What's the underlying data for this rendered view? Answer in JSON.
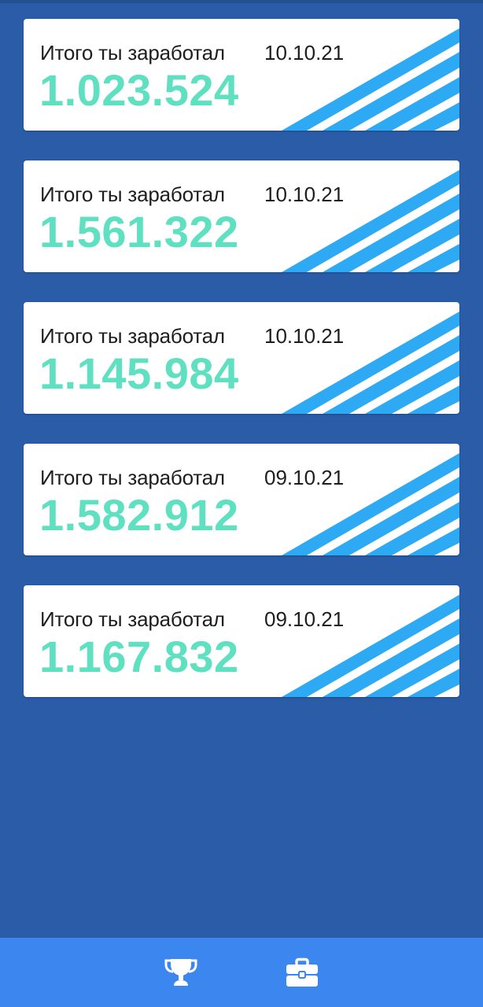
{
  "colors": {
    "background": "#2b5ca8",
    "card": "#ffffff",
    "amount": "#5fe0c0",
    "stripe": "#2eaaf5",
    "bottom_nav": "#3b86ef"
  },
  "cards": [
    {
      "label": "Итого ты заработал",
      "date": "10.10.21",
      "amount": "1.023.524"
    },
    {
      "label": "Итого ты заработал",
      "date": "10.10.21",
      "amount": "1.561.322"
    },
    {
      "label": "Итого ты заработал",
      "date": "10.10.21",
      "amount": "1.145.984"
    },
    {
      "label": "Итого ты заработал",
      "date": "09.10.21",
      "amount": "1.582.912"
    },
    {
      "label": "Итого ты заработал",
      "date": "09.10.21",
      "amount": "1.167.832"
    }
  ],
  "bottom_nav": {
    "items": [
      {
        "icon": "trophy-icon"
      },
      {
        "icon": "briefcase-icon"
      }
    ]
  }
}
